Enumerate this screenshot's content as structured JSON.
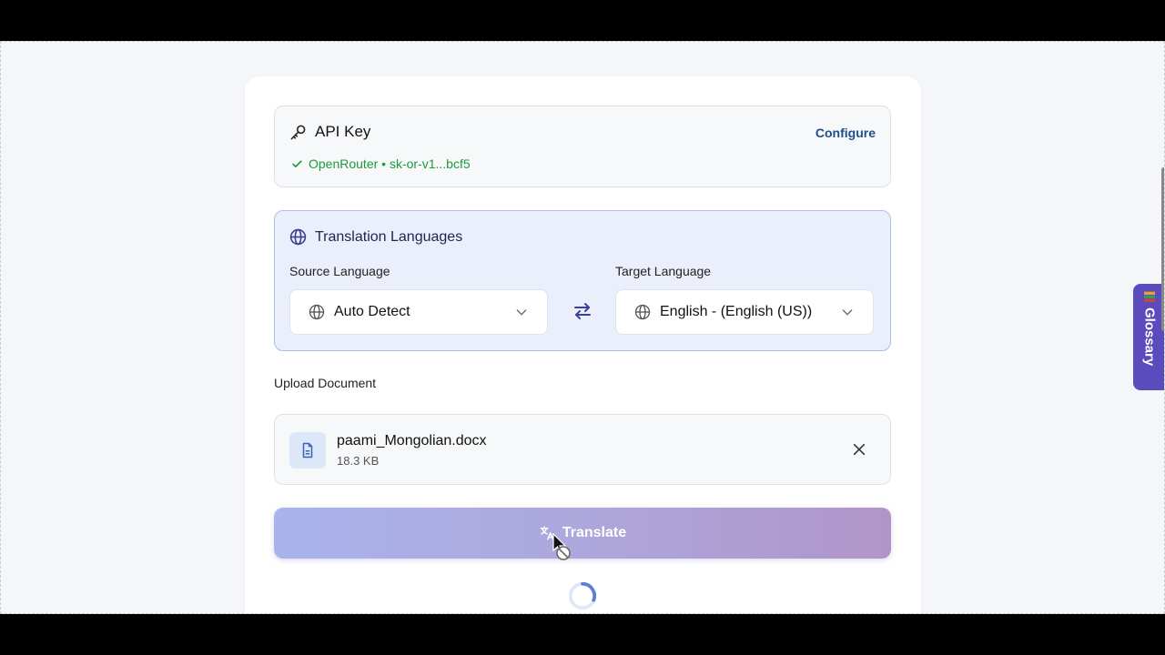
{
  "api_key": {
    "title": "API Key",
    "configure_label": "Configure",
    "status": "OpenRouter • sk-or-v1...bcf5",
    "icon": "key-icon"
  },
  "languages": {
    "title": "Translation Languages",
    "source_label": "Source Language",
    "source_value": "Auto Detect",
    "target_label": "Target Language",
    "target_value": "English - (English (US))"
  },
  "upload": {
    "label": "Upload Document",
    "file_name": "paami_Mongolian.docx",
    "file_size": "18.3 KB"
  },
  "translate_button": {
    "label": "Translate",
    "state": "disabled"
  },
  "glossary": {
    "label": "Glossary"
  },
  "colors": {
    "accent": "#5b4bbd",
    "success": "#1e9a3a",
    "link": "#1f4e8a"
  }
}
